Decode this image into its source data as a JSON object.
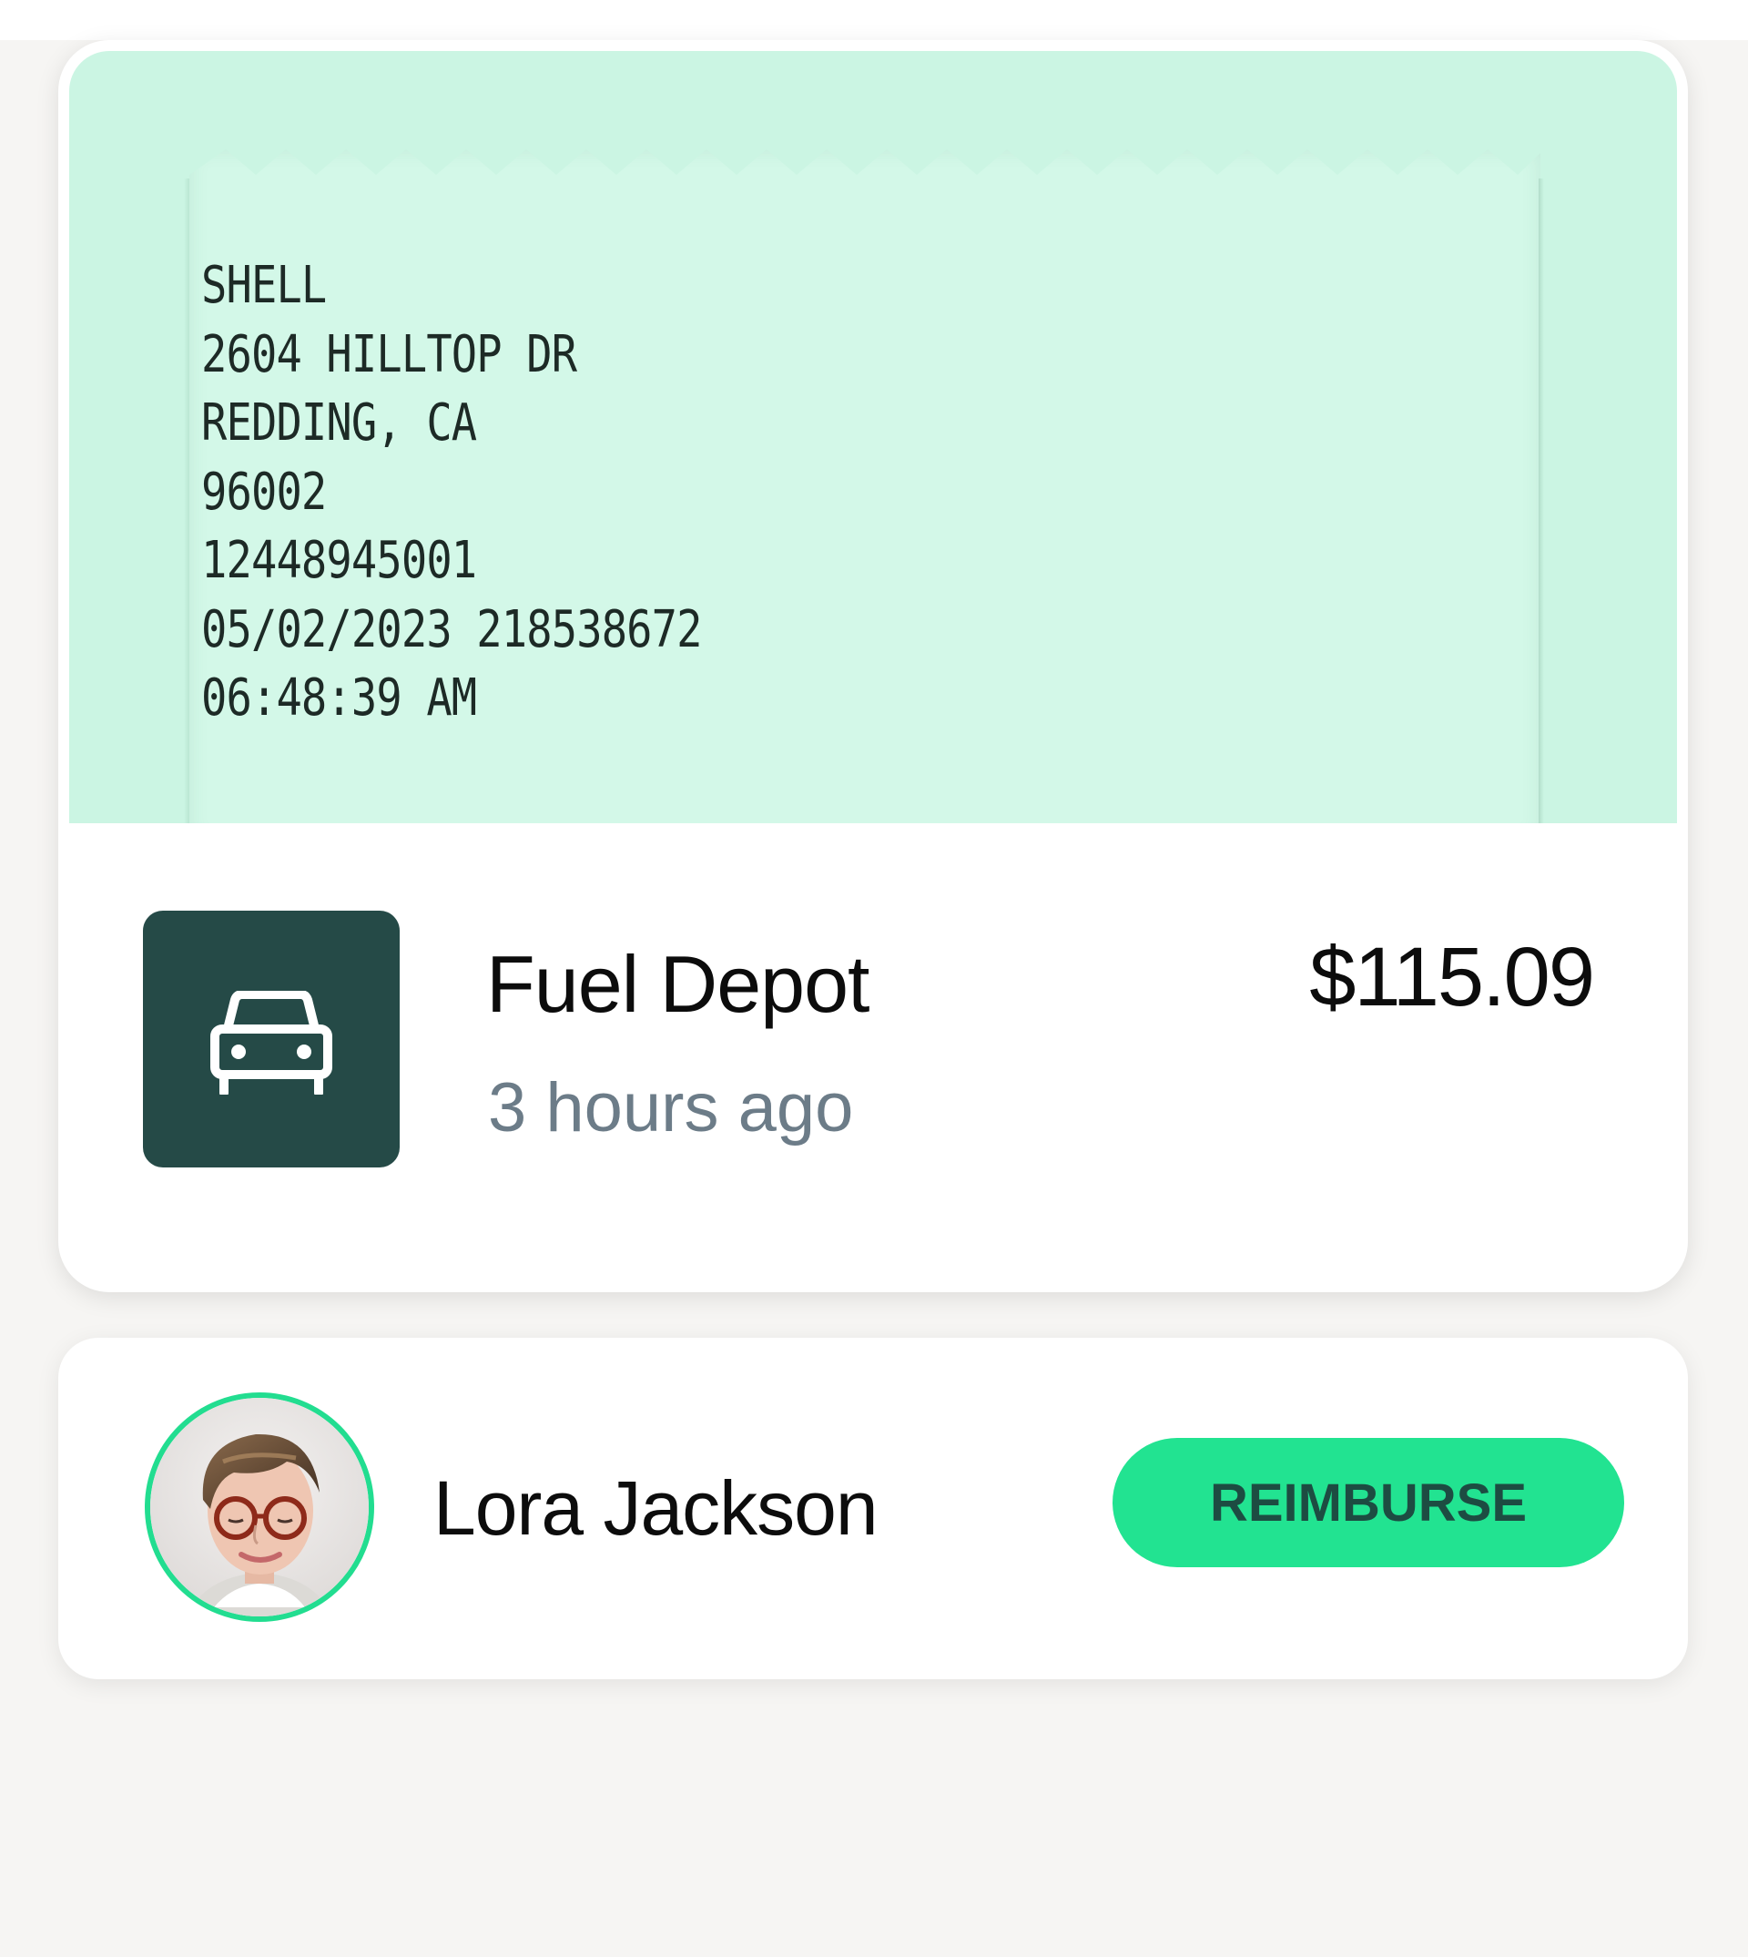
{
  "receipt": {
    "lines": [
      "SHELL",
      "2604 HILLTOP DR",
      "REDDING, CA",
      "96002",
      "12448945001",
      "05/02/2023 218538672",
      "06:48:39 AM"
    ]
  },
  "expense": {
    "category_icon": "car-icon",
    "merchant": "Fuel Depot",
    "time_ago": "3 hours ago",
    "amount": "$115.09"
  },
  "person": {
    "name": "Lora Jackson",
    "avatar": "avatar-photo",
    "action_label": "REIMBURSE"
  },
  "colors": {
    "receipt_background": "#cbf5e3",
    "category_tile": "#254a47",
    "accent_green": "#22e391",
    "button_text": "#1d4c42",
    "muted_text": "#6c7c88"
  }
}
